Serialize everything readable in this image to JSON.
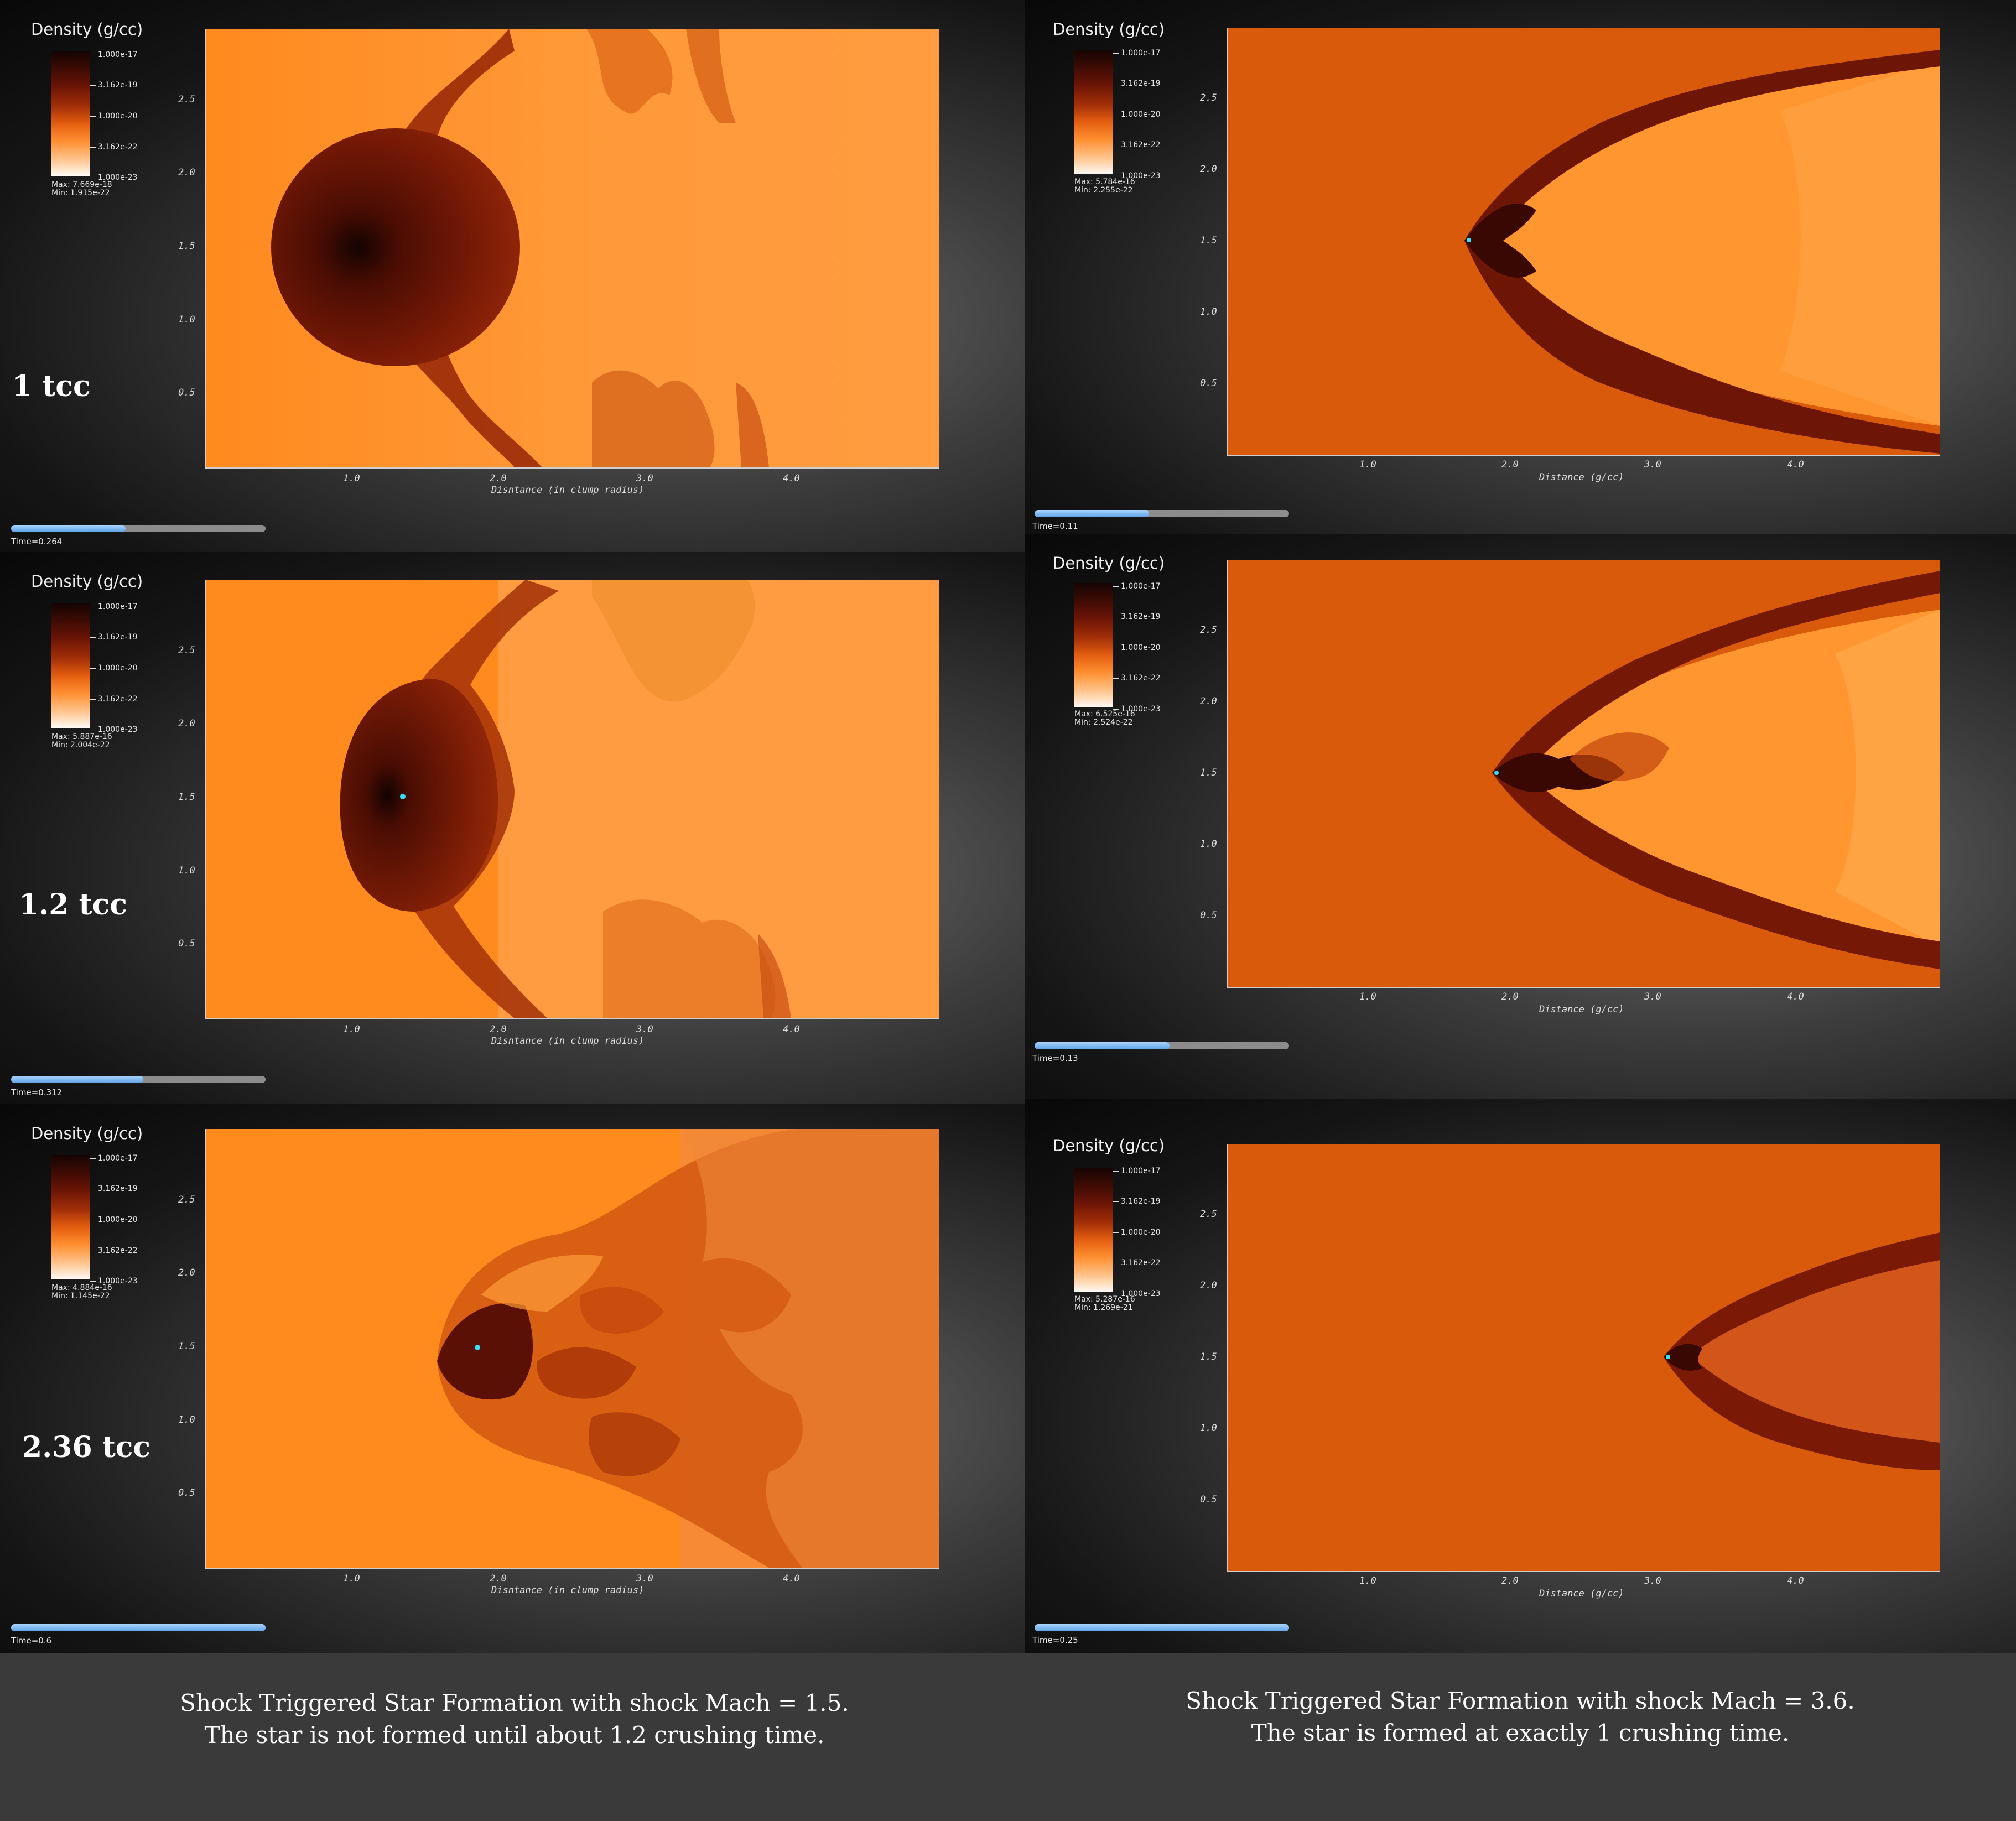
{
  "panels": [
    {
      "colorbar_title": "Density (g/cc)",
      "colorbar_ticks": [
        "1.000e-17",
        "3.162e-19",
        "1.000e-20",
        "3.162e-22",
        "1.000e-23"
      ],
      "max_label": "Max: 7.669e-18",
      "min_label": "Min: 1.915e-22",
      "y_ticks": [
        "2.5",
        "2.0",
        "1.5",
        "1.0",
        "0.5"
      ],
      "x_ticks": [
        "1.0",
        "2.0",
        "3.0",
        "4.0"
      ],
      "x_axis_title": "Disntance (in clump radius)",
      "crushing_time": "1 tcc",
      "time_label": "Time=0.264",
      "progress": 0.45
    },
    {
      "colorbar_title": "Density (g/cc)",
      "colorbar_ticks": [
        "1.000e-17",
        "3.162e-19",
        "1.000e-20",
        "3.162e-22",
        "1.000e-23"
      ],
      "max_label": "Max: 5.784e-16",
      "min_label": "Min: 2.255e-22",
      "y_ticks": [
        "2.5",
        "2.0",
        "1.5",
        "1.0",
        "0.5"
      ],
      "x_ticks": [
        "1.0",
        "2.0",
        "3.0",
        "4.0"
      ],
      "x_axis_title": "Distance (g/cc)",
      "crushing_time": "",
      "time_label": "Time=0.11",
      "progress": 0.45
    },
    {
      "colorbar_title": "Density (g/cc)",
      "colorbar_ticks": [
        "1.000e-17",
        "3.162e-19",
        "1.000e-20",
        "3.162e-22",
        "1.000e-23"
      ],
      "max_label": "Max: 5.887e-16",
      "min_label": "Min: 2.004e-22",
      "y_ticks": [
        "2.5",
        "2.0",
        "1.5",
        "1.0",
        "0.5"
      ],
      "x_ticks": [
        "1.0",
        "2.0",
        "3.0",
        "4.0"
      ],
      "x_axis_title": "Disntance (in clump radius)",
      "crushing_time": "1.2 tcc",
      "time_label": "Time=0.312",
      "progress": 0.52
    },
    {
      "colorbar_title": "Density (g/cc)",
      "colorbar_ticks": [
        "1.000e-17",
        "3.162e-19",
        "1.000e-20",
        "3.162e-22",
        "1.000e-23"
      ],
      "max_label": "Max: 6.525e-16",
      "min_label": "Min: 2.524e-22",
      "y_ticks": [
        "2.5",
        "2.0",
        "1.5",
        "1.0",
        "0.5"
      ],
      "x_ticks": [
        "1.0",
        "2.0",
        "3.0",
        "4.0"
      ],
      "x_axis_title": "Distance (g/cc)",
      "crushing_time": "",
      "time_label": "Time=0.13",
      "progress": 0.53
    },
    {
      "colorbar_title": "Density (g/cc)",
      "colorbar_ticks": [
        "1.000e-17",
        "3.162e-19",
        "1.000e-20",
        "3.162e-22",
        "1.000e-23"
      ],
      "max_label": "Max: 4.884e-16",
      "min_label": "Min: 1.145e-22",
      "y_ticks": [
        "2.5",
        "2.0",
        "1.5",
        "1.0",
        "0.5"
      ],
      "x_ticks": [
        "1.0",
        "2.0",
        "3.0",
        "4.0"
      ],
      "x_axis_title": "Disntance (in clump radius)",
      "crushing_time": "2.36 tcc",
      "time_label": "Time=0.6",
      "progress": 1.0
    },
    {
      "colorbar_title": "Density (g/cc)",
      "colorbar_ticks": [
        "1.000e-17",
        "3.162e-19",
        "1.000e-20",
        "3.162e-22",
        "1.000e-23"
      ],
      "max_label": "Max: 5.287e-16",
      "min_label": "Min: 1.269e-21",
      "y_ticks": [
        "2.5",
        "2.0",
        "1.5",
        "1.0",
        "0.5"
      ],
      "x_ticks": [
        "1.0",
        "2.0",
        "3.0",
        "4.0"
      ],
      "x_axis_title": "Distance (g/cc)",
      "crushing_time": "",
      "time_label": "Time=0.25",
      "progress": 1.0
    }
  ],
  "captions": {
    "left_line1": "Shock Triggered Star Formation with shock Mach = 1.5.",
    "left_line2": "The star is not formed until about 1.2 crushing time.",
    "right_line1": "Shock Triggered Star Formation with shock Mach = 3.6.",
    "right_line2": "The star is formed at exactly 1 crushing time."
  },
  "colors": {
    "ambient_low_mach": "#ff8a1e",
    "ambient_high_mach": "#d95a0a",
    "dense_gas": "#5a1205",
    "slider_fill": "#7ab8f5",
    "star": "#38e0ff"
  }
}
